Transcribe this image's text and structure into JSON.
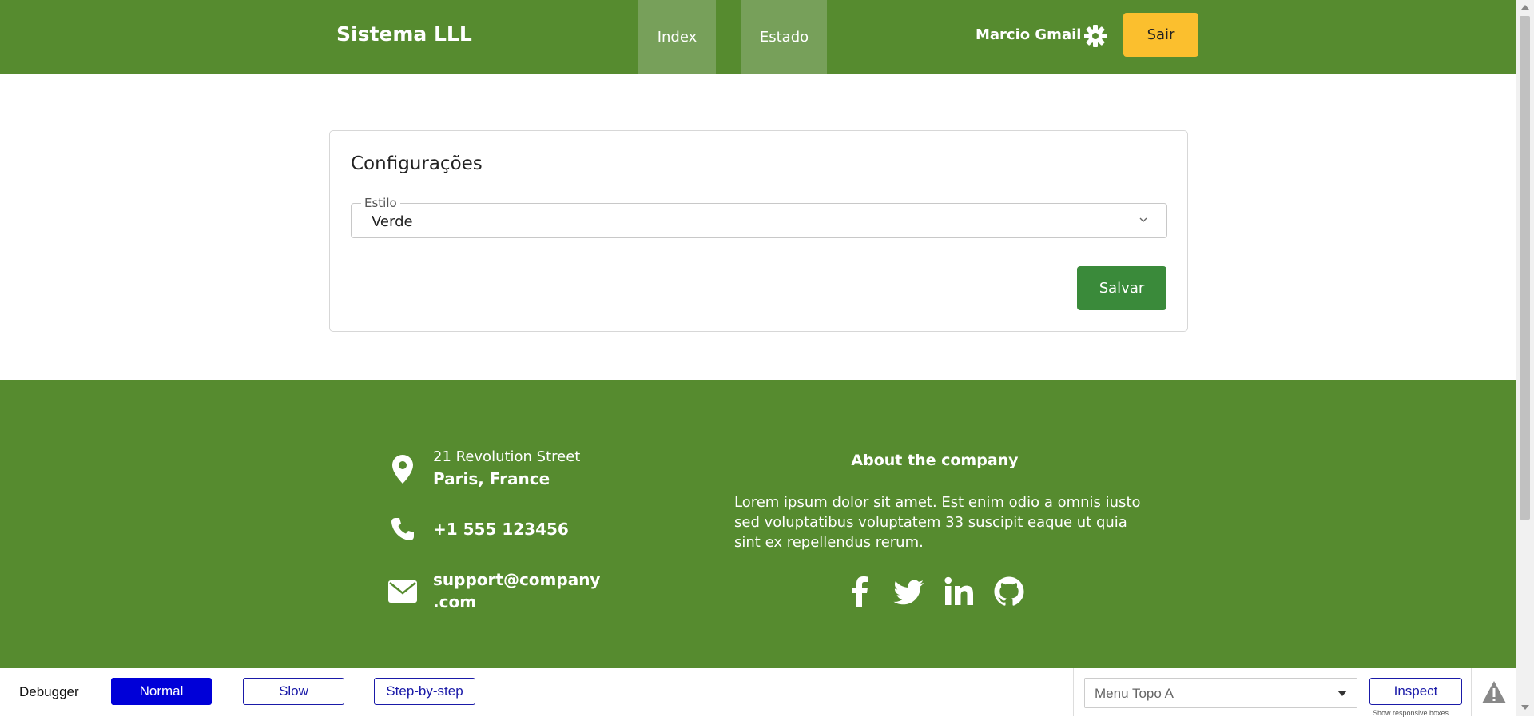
{
  "header": {
    "brand": "Sistema LLL",
    "tabs": [
      {
        "label": "Index"
      },
      {
        "label": "Estado"
      }
    ],
    "user_name": "Marcio Gmail",
    "settings_icon": "gear-icon",
    "logout_label": "Sair",
    "colors": {
      "bar": "#568b2f",
      "tab_active": "#77a05a",
      "logout": "#fbbf2e"
    }
  },
  "settings_card": {
    "title": "Configurações",
    "style_field": {
      "label": "Estilo",
      "value": "Verde"
    },
    "save_label": "Salvar",
    "colors": {
      "save": "#3a8a3a"
    }
  },
  "footer": {
    "address_street": "21 Revolution Street",
    "address_city": "Paris, France",
    "phone": "+1 555 123456",
    "email_line1": "support@company",
    "email_line2": ".com",
    "about_title": "About the company",
    "about_text": "Lorem ipsum dolor sit amet. Est enim odio a omnis iusto sed voluptatibus voluptatem 33 suscipit eaque ut quia sint ex repellendus rerum.",
    "social_icons": [
      "facebook-icon",
      "twitter-icon",
      "linkedin-icon",
      "github-icon"
    ]
  },
  "debugger": {
    "label": "Debugger",
    "modes": [
      {
        "label": "Normal",
        "active": true
      },
      {
        "label": "Slow",
        "active": false
      },
      {
        "label": "Step-by-step",
        "active": false
      }
    ],
    "menu_select": "Menu Topo A",
    "inspect_label": "Inspect",
    "responsive_note": "Show responsive boxes",
    "colors": {
      "active": "#0000d8",
      "outline": "#1a1aa8"
    }
  }
}
